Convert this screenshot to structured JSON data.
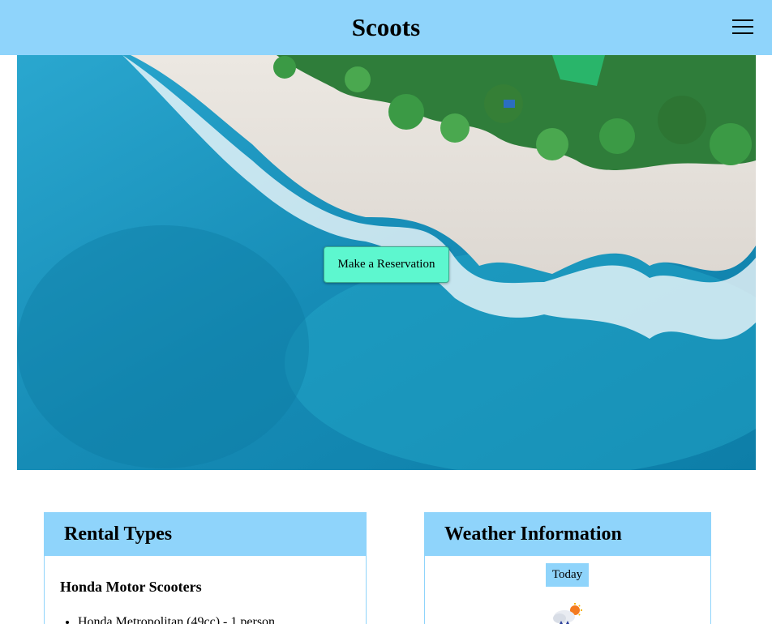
{
  "header": {
    "title": "Scoots",
    "menu_icon": "hamburger-menu-icon"
  },
  "hero": {
    "image": "aerial tropical beach photo",
    "reserve_label": "Make a Reservation"
  },
  "rental": {
    "title": "Rental Types",
    "section_title": "Honda Motor Scooters",
    "items": [
      "Honda Metropolitan (49cc) - 1 person"
    ]
  },
  "weather": {
    "title": "Weather Information",
    "today_label": "Today",
    "icon": "partly-cloudy-rain-icon"
  },
  "colors": {
    "header_bg": "#8fd4fb",
    "button_bg": "#5df7cf"
  }
}
